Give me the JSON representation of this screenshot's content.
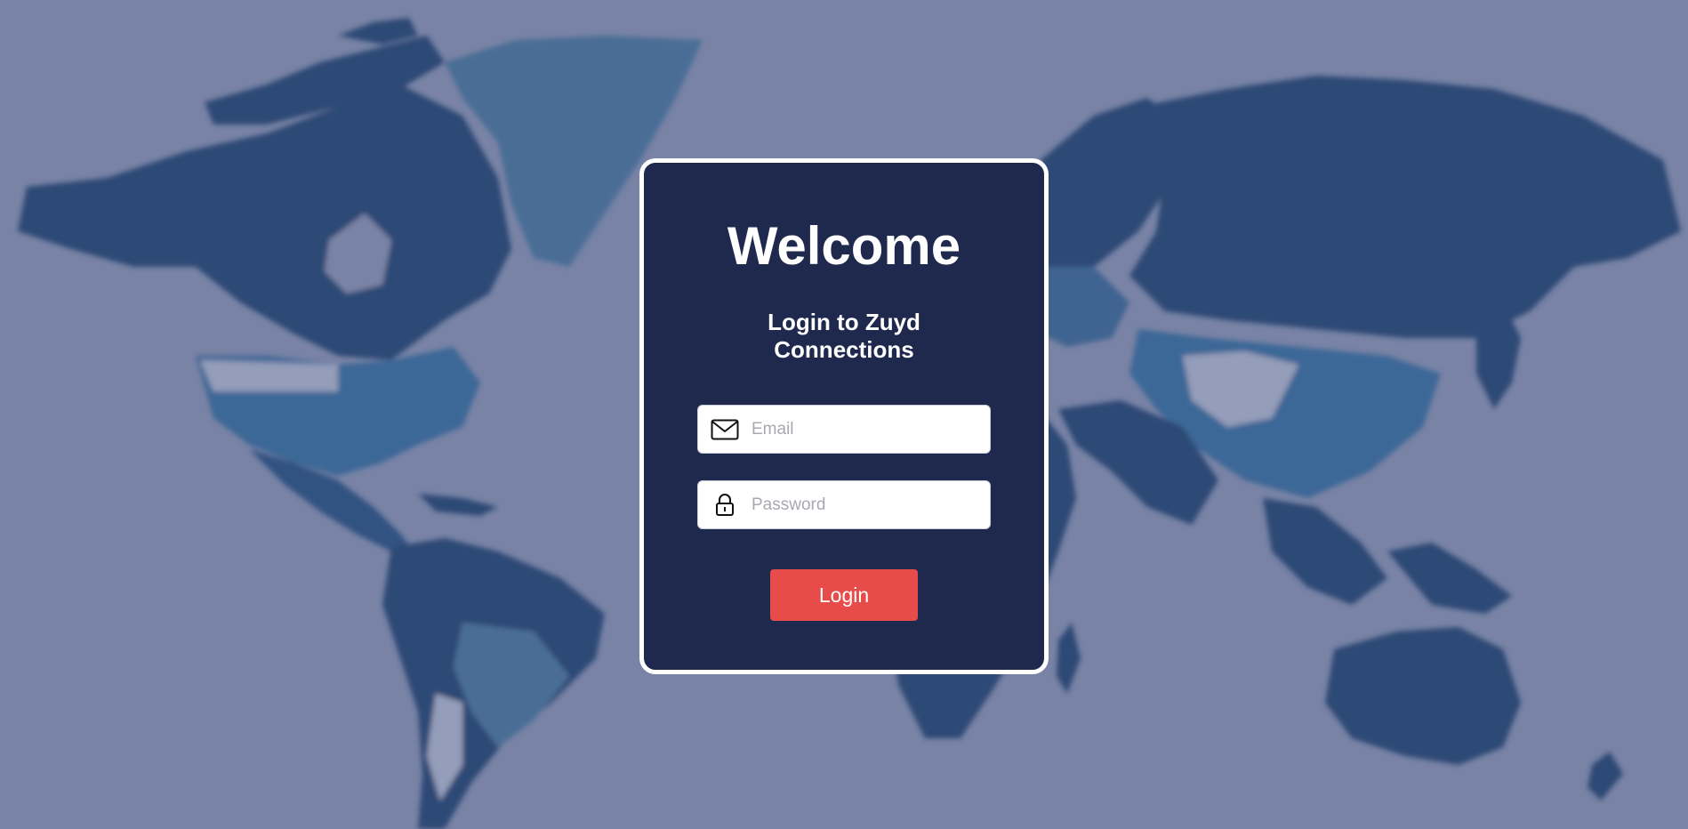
{
  "login_card": {
    "title": "Welcome",
    "subtitle": "Login to Zuyd Connections",
    "email": {
      "placeholder": "Email",
      "value": "",
      "icon": "envelope-icon"
    },
    "password": {
      "placeholder": "Password",
      "value": "",
      "icon": "lock-icon"
    },
    "login_button": "Login"
  },
  "colors": {
    "background": "#7a84a4",
    "card": "#1f294e",
    "card_border": "#ffffff",
    "button": "#e84c4a",
    "land_dark": "#1b3a66",
    "land_light": "#3f6e99"
  }
}
